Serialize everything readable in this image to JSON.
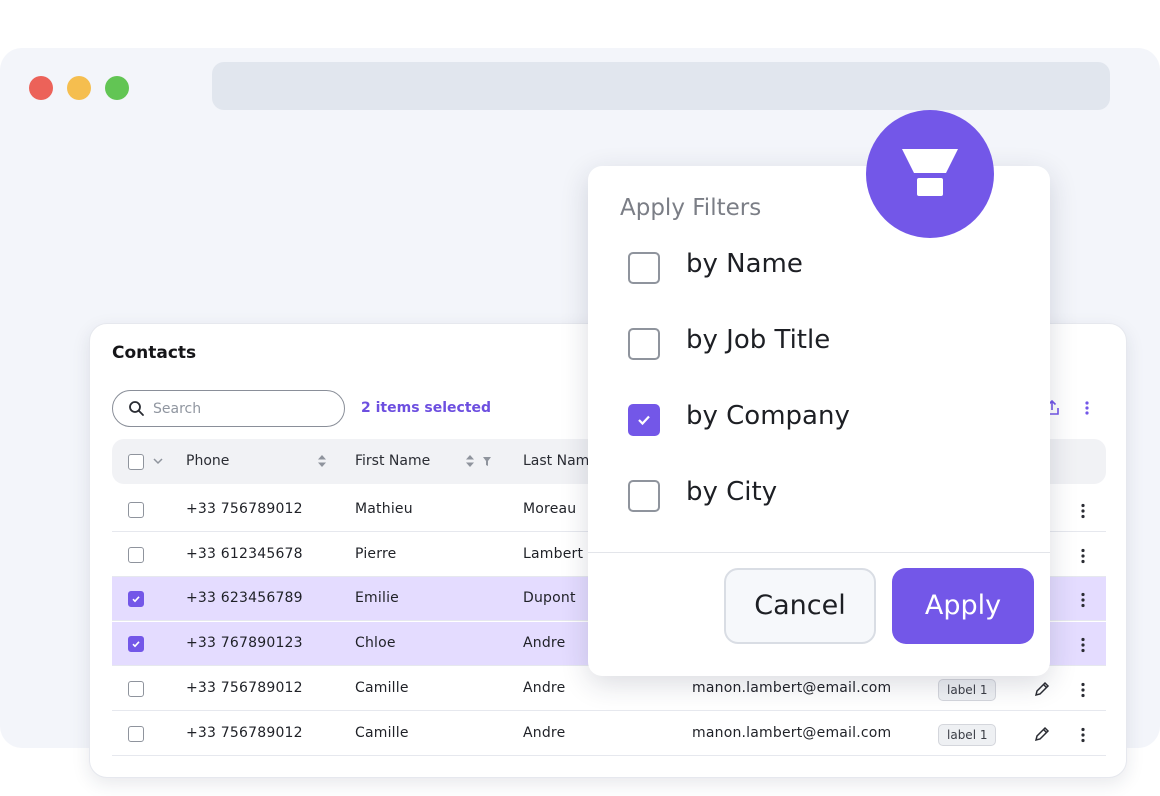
{
  "window": {
    "traffic_lights": [
      "close",
      "minimize",
      "maximize"
    ],
    "colors": {
      "close": "#ec6259",
      "minimize": "#f5be4f",
      "maximize": "#62c554"
    }
  },
  "contacts": {
    "title": "Contacts",
    "search_placeholder": "Search",
    "selected_label": "2 items selected",
    "columns": [
      "Phone",
      "First Name",
      "Last Name"
    ],
    "rows": [
      {
        "checked": false,
        "phone": "+33 756789012",
        "first": "Mathieu",
        "last": "Moreau",
        "email": "",
        "label": ""
      },
      {
        "checked": false,
        "phone": "+33 612345678",
        "first": "Pierre",
        "last": "Lambert",
        "email": "",
        "label": ""
      },
      {
        "checked": true,
        "phone": "+33 623456789",
        "first": "Emilie",
        "last": "Dupont",
        "email": "",
        "label": ""
      },
      {
        "checked": true,
        "phone": "+33 767890123",
        "first": "Chloe",
        "last": "Andre",
        "email": "",
        "label": ""
      },
      {
        "checked": false,
        "phone": "+33 756789012",
        "first": "Camille",
        "last": "Andre",
        "email": "manon.lambert@email.com",
        "label": "label 1"
      },
      {
        "checked": false,
        "phone": "+33 756789012",
        "first": "Camille",
        "last": "Andre",
        "email": "manon.lambert@email.com",
        "label": "label 1"
      }
    ]
  },
  "filters": {
    "title": "Apply Filters",
    "options": [
      {
        "label": "by Name",
        "checked": false
      },
      {
        "label": "by Job Title",
        "checked": false
      },
      {
        "label": "by Company",
        "checked": true
      },
      {
        "label": "by City",
        "checked": false
      }
    ],
    "cancel_label": "Cancel",
    "apply_label": "Apply",
    "icon": "filter-funnel-icon"
  },
  "colors": {
    "accent": "#7357e8",
    "selected_row": "#e4dcff"
  }
}
